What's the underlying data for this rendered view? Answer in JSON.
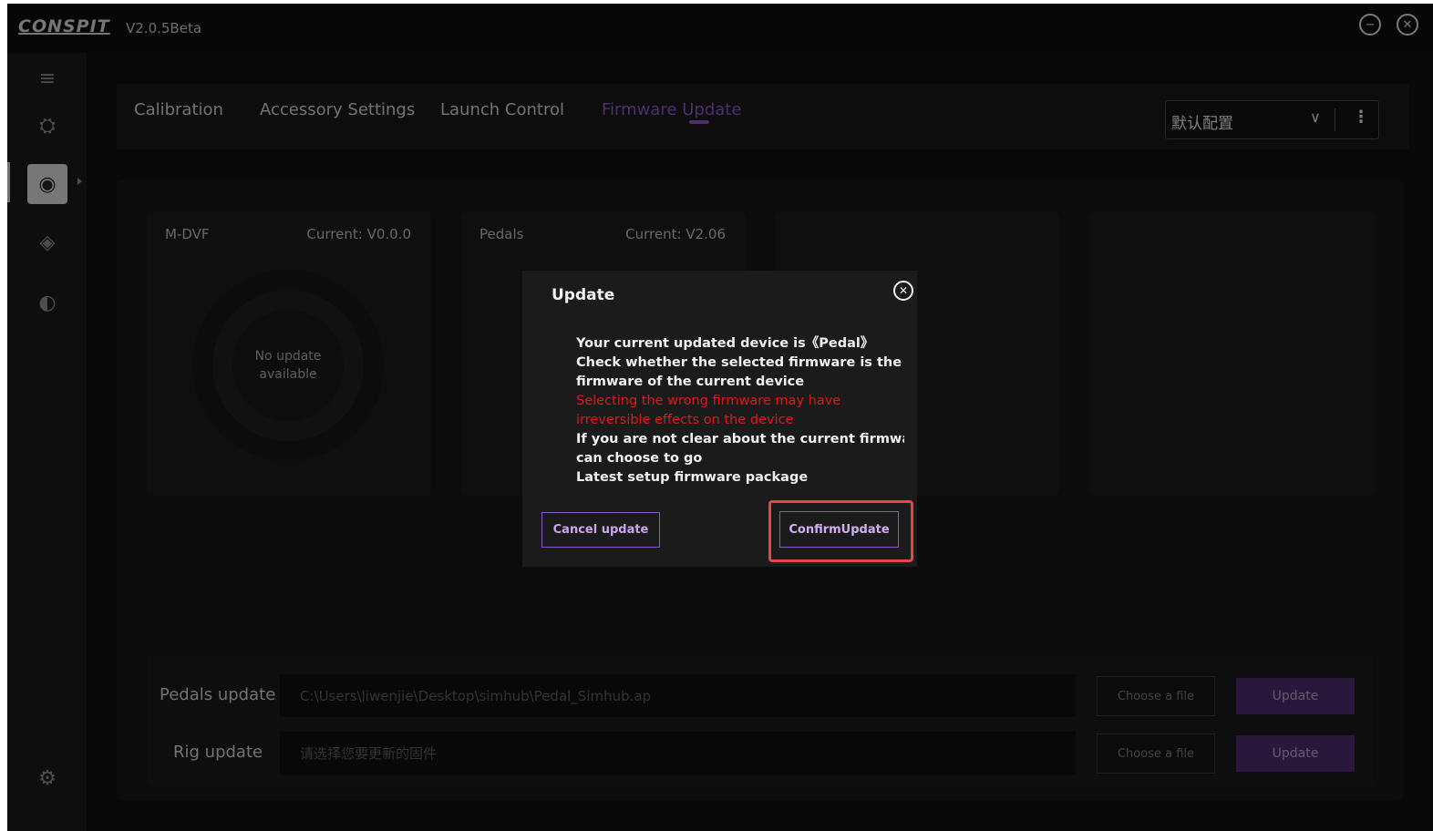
{
  "app": {
    "logo_text": "CONSPIT",
    "version": "V2.0.5Beta",
    "window_controls": {
      "minimize_icon": "minus-circle-icon",
      "close_icon": "close-circle-icon"
    }
  },
  "sidebar": {
    "items": [
      {
        "icon": "menu-icon",
        "glyph": "≡"
      },
      {
        "icon": "engine-icon",
        "glyph": "⛭"
      },
      {
        "icon": "steering-wheel-icon",
        "glyph": "◉",
        "active": true
      },
      {
        "icon": "layers-icon",
        "glyph": "◈"
      },
      {
        "icon": "helmet-icon",
        "glyph": "◐"
      }
    ],
    "settings_icon": "gear-icon",
    "settings_glyph": "⚙"
  },
  "tabs": [
    {
      "label": "Calibration"
    },
    {
      "label": "Accessory Settings"
    },
    {
      "label": "Launch Control"
    },
    {
      "label": "Firmware Update",
      "active": true
    }
  ],
  "config_select": {
    "value": "默认配置"
  },
  "devices": [
    {
      "name": "M-DVF",
      "current": "Current: V0.0.0",
      "status": "No update available"
    },
    {
      "name": "Pedals",
      "current": "Current: V2.06"
    }
  ],
  "updates": {
    "pedals": {
      "label": "Pedals update",
      "path": "C:\\Users\\liwenjie\\Desktop\\simhub\\Pedal_Simhub.ap",
      "choose_label": "Choose a file",
      "update_label": "Update"
    },
    "rig": {
      "label": "Rig update",
      "placeholder": "请选择您要更新的固件",
      "choose_label": "Choose a file",
      "update_label": "Update"
    }
  },
  "dialog": {
    "title": "Update",
    "line1": "Your current updated device is《Pedal》",
    "line2": "Check whether the selected firmware is the",
    "line3": "firmware of the current device",
    "warning1": "Selecting the wrong firmware may have",
    "warning2": "irreversible effects on the device",
    "line4": "If you are not clear about the current firmware, y",
    "line5": "can choose to go",
    "line6": "Latest setup firmware package",
    "cancel_label": "Cancel update",
    "confirm_label": "ConfirmUpdate",
    "highlight_color": "#e84545"
  },
  "colors": {
    "accent": "#8d56c9",
    "warning": "#e0181a"
  }
}
